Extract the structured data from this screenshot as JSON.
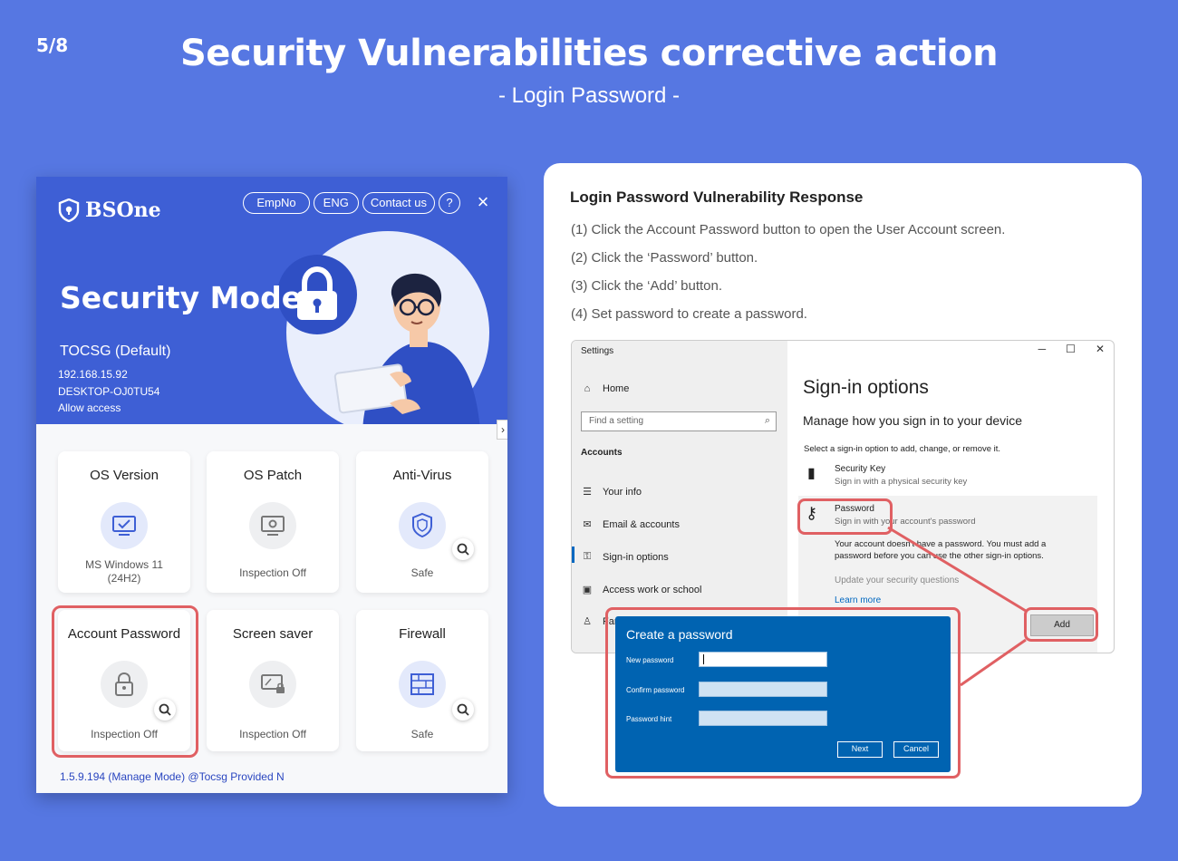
{
  "slide": {
    "page_number": "5/8",
    "title": "Security Vulnerabilities corrective action",
    "subtitle": "- Login Password -"
  },
  "app": {
    "brand": "BSOne",
    "header_buttons": {
      "empno": "EmpNo",
      "lang": "ENG",
      "contact": "Contact us",
      "help": "?",
      "close": "×"
    },
    "mode_title": "Security Mode",
    "org_name": "TOCSG (Default)",
    "ip": "192.168.15.92",
    "host": "DESKTOP-OJ0TU54",
    "access": "Allow access",
    "collapse": "›",
    "cards": [
      {
        "title": "OS Version",
        "status_line1": "MS Windows 11",
        "status_line2": "(24H2)",
        "icon": "monitor-check-icon",
        "state": "ok"
      },
      {
        "title": "OS Patch",
        "status_line1": "Inspection Off",
        "icon": "monitor-gear-icon",
        "state": "off"
      },
      {
        "title": "Anti-Virus",
        "status_line1": "Safe",
        "icon": "shield-icon",
        "state": "ok"
      },
      {
        "title": "Account Password",
        "status_line1": "Inspection Off",
        "icon": "lock-icon",
        "state": "off"
      },
      {
        "title": "Screen saver",
        "status_line1": "Inspection Off",
        "icon": "screen-lock-icon",
        "state": "off"
      },
      {
        "title": "Firewall",
        "status_line1": "Safe",
        "icon": "firewall-icon",
        "state": "ok"
      }
    ],
    "footer": "1.5.9.194 (Manage Mode) @Tocsg Provided N"
  },
  "panel": {
    "title": "Login Password Vulnerability Response",
    "steps": [
      "(1) Click the Account Password button to open the User Account screen.",
      "(2) Click the ‘Password’ button.",
      "(3) Click the ‘Add’ button.",
      "(4) Set password to create a password."
    ]
  },
  "settings": {
    "window_title": "Settings",
    "home": "Home",
    "search_placeholder": "Find a setting",
    "section": "Accounts",
    "nav": [
      "Your info",
      "Email & accounts",
      "Sign-in options",
      "Access work or school",
      "Fam"
    ],
    "page_title": "Sign-in options",
    "page_subtitle": "Manage how you sign in to your device",
    "page_desc": "Select a sign-in option to add, change, or remove it.",
    "security_key_name": "Security Key",
    "security_key_desc": "Sign in with a physical security key",
    "password_name": "Password",
    "password_desc": "Sign in with your account's password",
    "password_msg": "Your account doesn't have a password. You must add a password before you can use the other sign-in options.",
    "update_questions": "Update your security questions",
    "learn_more": "Learn more",
    "add_button": "Add"
  },
  "dialog": {
    "title": "Create a password",
    "new_password": "New password",
    "confirm_password": "Confirm password",
    "password_hint": "Password hint",
    "next": "Next",
    "cancel": "Cancel"
  },
  "colors": {
    "background": "#5677e2",
    "app_header": "#3e5fd5",
    "highlight": "#e06063",
    "dialog": "#0063b1",
    "link": "#0067c0"
  }
}
